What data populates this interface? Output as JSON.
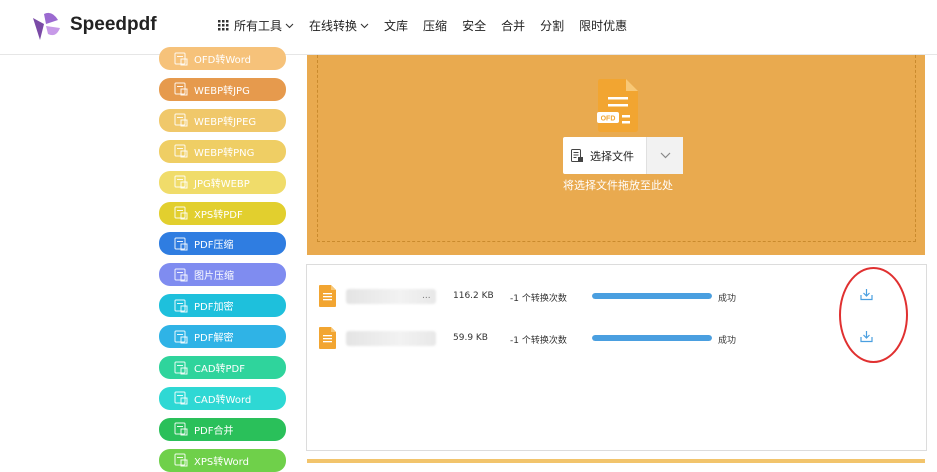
{
  "brand": {
    "name": "Speedpdf"
  },
  "nav": [
    {
      "label": "所有工具",
      "has_caret": true,
      "has_grid": true
    },
    {
      "label": "在线转换",
      "has_caret": true
    },
    {
      "label": "文库"
    },
    {
      "label": "压缩"
    },
    {
      "label": "安全"
    },
    {
      "label": "合并"
    },
    {
      "label": "分割"
    },
    {
      "label": "限时优惠"
    }
  ],
  "sidebar": [
    {
      "label": "OFD转Word",
      "color": "#f6c27a"
    },
    {
      "label": "WEBP转JPG",
      "color": "#e69a4d"
    },
    {
      "label": "WEBP转JPEG",
      "color": "#f0c86a"
    },
    {
      "label": "WEBP转PNG",
      "color": "#efce64"
    },
    {
      "label": "JPG转WEBP",
      "color": "#f0dc6a"
    },
    {
      "label": "XPS转PDF",
      "color": "#e2cf2e"
    },
    {
      "label": "PDF压缩",
      "color": "#2f7de1"
    },
    {
      "label": "图片压缩",
      "color": "#7f8cf0"
    },
    {
      "label": "PDF加密",
      "color": "#1ec0dc"
    },
    {
      "label": "PDF解密",
      "color": "#2fb3e6"
    },
    {
      "label": "CAD转PDF",
      "color": "#2fd49c"
    },
    {
      "label": "CAD转Word",
      "color": "#2ed8d4"
    },
    {
      "label": "PDF合并",
      "color": "#2ac05a"
    },
    {
      "label": "XPS转Word",
      "color": "#6fd04a"
    }
  ],
  "upload": {
    "select_label": "选择文件",
    "hint": "将选择文件拖放至此处",
    "file_badge": "OFD"
  },
  "files": [
    {
      "name_suffix": "...",
      "size": "116.2 KB",
      "count": "-1 个转换次数",
      "progress": 1.0,
      "status": "成功"
    },
    {
      "name_suffix": "",
      "size": "59.9 KB",
      "count": "-1 个转换次数",
      "progress": 1.0,
      "status": "成功"
    }
  ],
  "colors": {
    "accent": "#e9aa4f",
    "progress": "#4a9fe0",
    "annotation": "#e03030"
  }
}
